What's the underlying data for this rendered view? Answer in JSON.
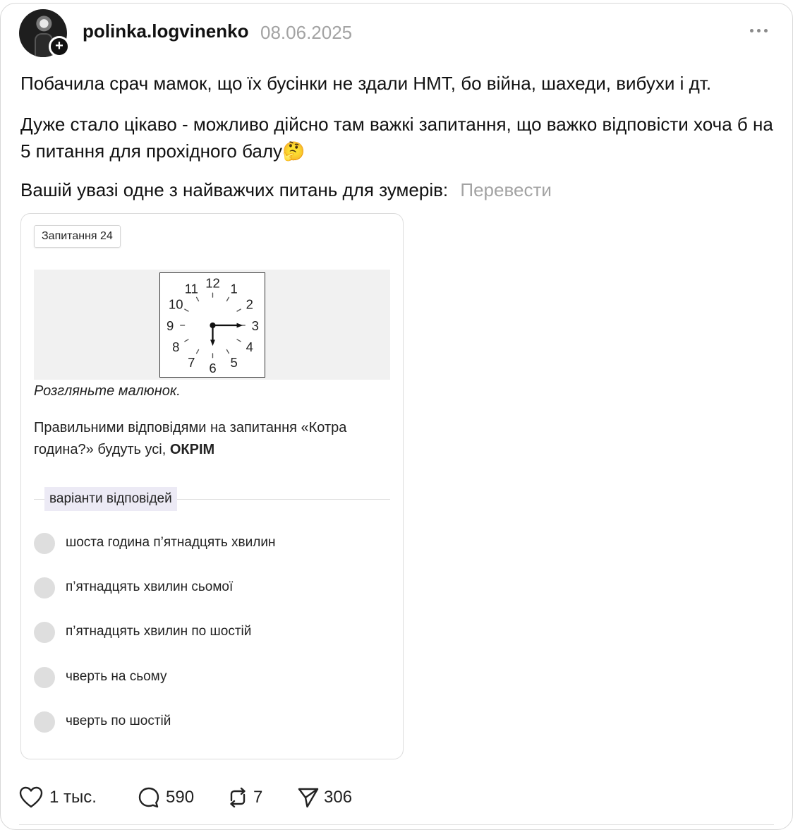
{
  "post": {
    "username": "polinka.logvinenko",
    "date": "08.06.2025",
    "follow_symbol": "+",
    "paragraphs": [
      "Побачила срач мамок, що їх бусінки не здали НМТ, бо війна, шахеди, вибухи і дт.",
      "Дуже стало цікаво - можливо дійсно там важкі запитання, що важко відповісти хоча б на 5 питання для прохідного балу🤔",
      "Вашій увазі одне з найважчих питань для зумерів:"
    ],
    "translate_label": "Перевести"
  },
  "card": {
    "question_tag": "Запитання 24",
    "clock_numbers": [
      "12",
      "1",
      "2",
      "3",
      "4",
      "5",
      "6",
      "7",
      "8",
      "9",
      "10",
      "11"
    ],
    "clock_time": {
      "hour_hand": 6,
      "minute_hand": 15
    },
    "caption": "Розгляньте малюнок.",
    "question_text": "Правильними відповідями на запитання «Котра година?» будуть усі,",
    "question_emphasis": "ОКРІМ",
    "variants_label": "варіанти відповідей",
    "options": [
      "шоста година п’ятнадцять хвилин",
      "п’ятнадцять хвилин сьомої",
      "п’ятнадцять хвилин по шостій",
      "чверть на сьому",
      "чверть по шостій"
    ]
  },
  "actions": {
    "likes": "1 тыс.",
    "comments": "590",
    "reposts": "7",
    "shares": "306"
  }
}
